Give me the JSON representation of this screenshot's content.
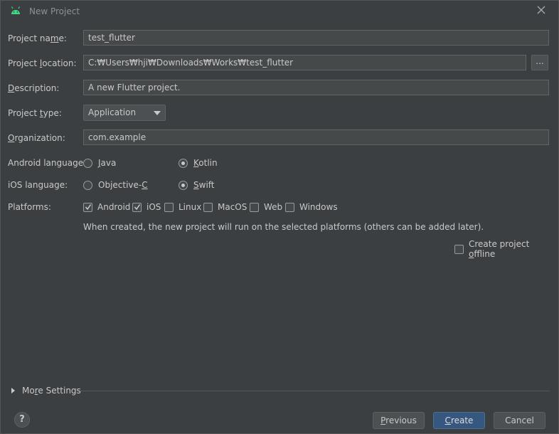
{
  "window": {
    "title": "New Project",
    "icon": "android-icon"
  },
  "form": {
    "project_name": {
      "label_pre": "Project na",
      "label_mn": "m",
      "label_post": "e:",
      "value": "test_flutter"
    },
    "project_location": {
      "label_pre": "Project ",
      "label_mn": "l",
      "label_post": "ocation:",
      "value": "C:₩Users₩hji₩Downloads₩Works₩test_flutter",
      "browse_label": "..."
    },
    "description": {
      "label_mn": "D",
      "label_post": "escription:",
      "value": "A new Flutter project."
    },
    "project_type": {
      "label_pre": "Project ",
      "label_mn": "t",
      "label_post": "ype:",
      "value": "Application"
    },
    "organization": {
      "label_mn": "O",
      "label_post": "rganization:",
      "value": "com.example"
    },
    "android_language": {
      "label": "Android language:",
      "options": [
        {
          "mn": "J",
          "rest": "ava",
          "selected": false
        },
        {
          "mn": "K",
          "rest": "otlin",
          "selected": true
        }
      ]
    },
    "ios_language": {
      "label": "iOS language:",
      "options": [
        {
          "pre": "Objective-",
          "mn": "C",
          "selected": false
        },
        {
          "mn": "S",
          "rest": "wift",
          "selected": true
        }
      ]
    },
    "platforms": {
      "label": "Platforms:",
      "items": [
        {
          "label": "Android",
          "checked": true
        },
        {
          "label": "iOS",
          "checked": true
        },
        {
          "label": "Linux",
          "checked": false
        },
        {
          "label": "MacOS",
          "checked": false
        },
        {
          "label": "Web",
          "checked": false
        },
        {
          "label": "Windows",
          "checked": false
        }
      ],
      "note": "When created, the new project will run on the selected platforms (others can be added later)."
    },
    "offline": {
      "label_pre": "Create project ",
      "label_mn": "o",
      "label_post": "ffline",
      "checked": false
    }
  },
  "more_settings": {
    "pre": "Mo",
    "mn": "r",
    "post": "e Settings"
  },
  "footer": {
    "help_label": "?",
    "previous": {
      "mn": "P",
      "rest": "revious"
    },
    "create": {
      "mn": "C",
      "rest": "reate"
    },
    "cancel_label": "Cancel"
  },
  "colors": {
    "primary_button": "#365880",
    "background": "#3c3f41",
    "android_green": "#3ddc84"
  }
}
